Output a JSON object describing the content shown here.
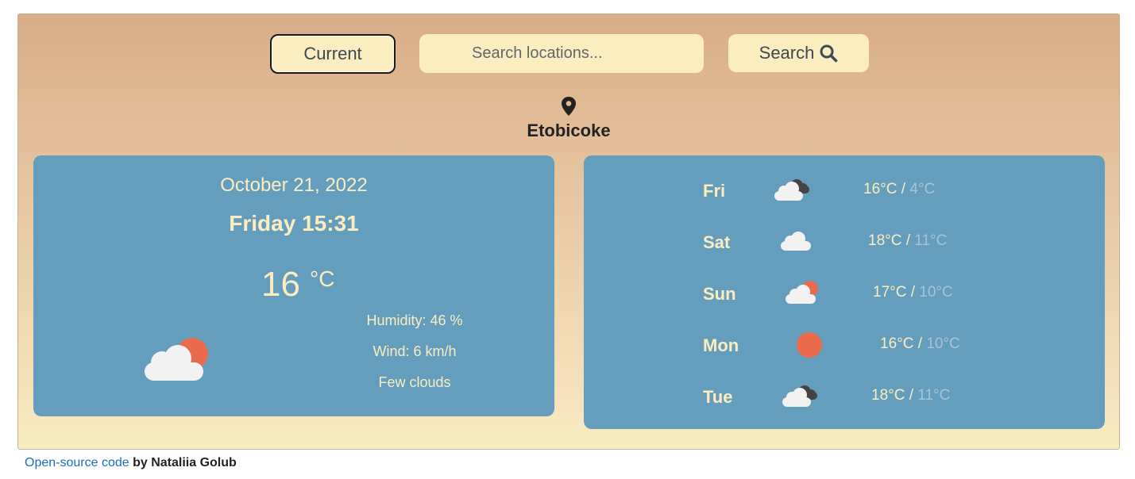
{
  "header": {
    "current_label": "Current",
    "search_placeholder": "Search locations...",
    "search_label": "Search"
  },
  "location": {
    "name": "Etobicoke"
  },
  "today": {
    "date": "October 21, 2022",
    "day_time": "Friday 15:31",
    "temperature": "16",
    "unit": "°C",
    "humidity": "Humidity: 46 %",
    "wind": "Wind: 6 km/h",
    "description": "Few clouds",
    "icon": "sun-behind-cloud-icon"
  },
  "forecast": [
    {
      "day": "Fri",
      "max": "16°C",
      "sep": " / ",
      "min": "4°C",
      "icon": "broken-clouds-icon"
    },
    {
      "day": "Sat",
      "max": "18°C",
      "sep": " / ",
      "min": "11°C",
      "icon": "cloud-icon"
    },
    {
      "day": "Sun",
      "max": "17°C",
      "sep": " / ",
      "min": "10°C",
      "icon": "sun-behind-cloud-icon"
    },
    {
      "day": "Mon",
      "max": "16°C",
      "sep": " / ",
      "min": "10°C",
      "icon": "sun-icon"
    },
    {
      "day": "Tue",
      "max": "18°C",
      "sep": " / ",
      "min": "11°C",
      "icon": "broken-clouds-icon"
    }
  ],
  "footer": {
    "link_text": "Open-source code",
    "author_text": " by Nataliia Golub"
  },
  "colors": {
    "card": "#659dbc",
    "cream": "#fbedbf",
    "sun": "#ea6b4c",
    "link": "#1b6ec2"
  }
}
